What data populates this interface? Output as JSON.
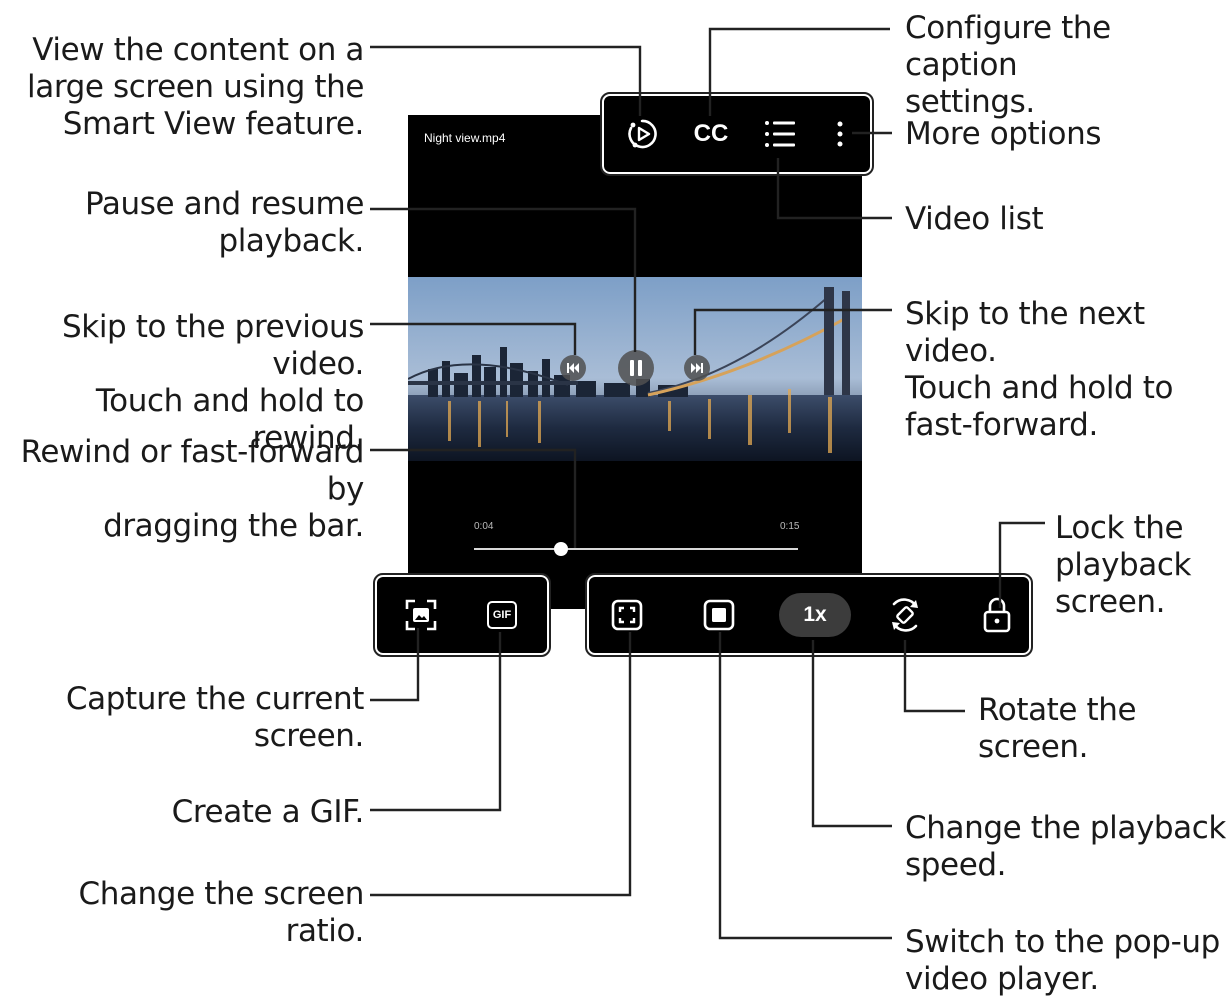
{
  "player": {
    "filename": "Night view.mp4",
    "current_time": "0:04",
    "total_time": "0:15",
    "progress": 0.27,
    "speed_label": "1x",
    "gif_label": "GIF",
    "cc_label": "CC"
  },
  "callouts": {
    "smart_view": [
      "View the content on a",
      "large screen using the",
      "Smart View feature."
    ],
    "pause": [
      "Pause and resume",
      "playback."
    ],
    "previous": [
      "Skip to the previous video.",
      "Touch and hold to rewind."
    ],
    "seek": [
      "Rewind or fast-forward by",
      "dragging the bar."
    ],
    "capture": [
      "Capture the current",
      "screen."
    ],
    "gif": [
      "Create a GIF."
    ],
    "ratio": [
      "Change the screen ratio."
    ],
    "caption": [
      "Configure the caption",
      "settings."
    ],
    "more": [
      "More options"
    ],
    "video_list": [
      "Video list"
    ],
    "next": [
      "Skip to the next video.",
      "Touch and hold to",
      "fast-forward."
    ],
    "lock": [
      "Lock the",
      "playback",
      "screen."
    ],
    "rotate": [
      "Rotate the screen."
    ],
    "speed": [
      "Change the playback",
      "speed."
    ],
    "popup": [
      "Switch to the pop-up",
      "video player."
    ]
  },
  "icons": [
    "smart-view-icon",
    "closed-caption-icon",
    "video-list-icon",
    "more-options-icon",
    "previous-icon",
    "pause-icon",
    "next-icon",
    "capture-icon",
    "gif-icon",
    "screen-ratio-icon",
    "popup-player-icon",
    "rotate-icon",
    "lock-icon"
  ],
  "colors": {
    "background": "#ffffff",
    "player": "#000000",
    "text": "#1a1a1a",
    "line": "#222222"
  }
}
